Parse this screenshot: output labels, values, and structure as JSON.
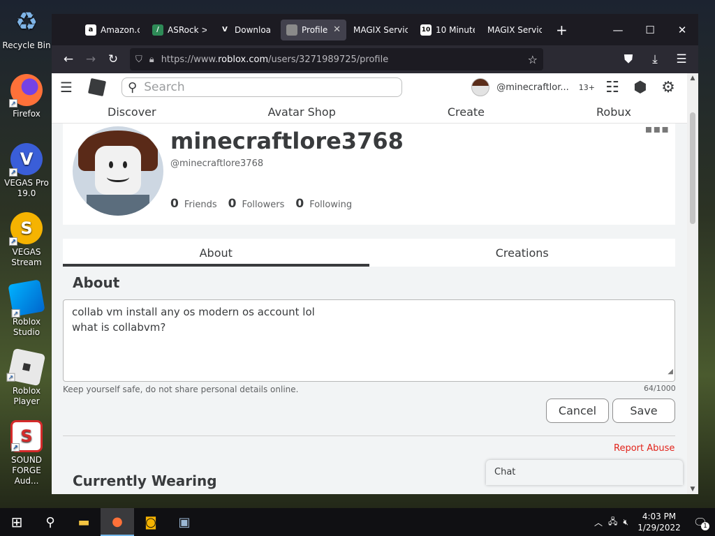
{
  "desktop": {
    "icons": [
      {
        "label": "Recycle Bin",
        "glyph": "♻",
        "color": "#2d8fd6"
      },
      {
        "label": "Firefox",
        "glyph": "●",
        "color": "#ff7139"
      },
      {
        "label": "VEGAS Pro 19.0",
        "glyph": "V",
        "color": "#3a6fd8"
      },
      {
        "label": "VEGAS Stream",
        "glyph": "S",
        "color": "#f5b301"
      },
      {
        "label": "Roblox Studio",
        "glyph": "■",
        "color": "#00a2ff"
      },
      {
        "label": "Roblox Player",
        "glyph": "◆",
        "color": "#e8e8e8"
      },
      {
        "label": "SOUND FORGE Aud...",
        "glyph": "S",
        "color": "#d42b2b"
      }
    ]
  },
  "browser": {
    "tabs": [
      {
        "label": "Amazon.c",
        "icon": "a",
        "color": "#ffffff",
        "active": false
      },
      {
        "label": "ASRock >",
        "icon": "/",
        "color": "#2e8b57",
        "active": false
      },
      {
        "label": "Downloa",
        "icon": "V",
        "color": "#1c1b22",
        "active": false
      },
      {
        "label": "Profile",
        "icon": "■",
        "color": "#7a7a7a",
        "active": true,
        "close": "✕"
      },
      {
        "label": "MAGIX Servic",
        "icon": "",
        "color": "",
        "active": false
      },
      {
        "label": "10 Minute",
        "icon": "10",
        "color": "#ffffff",
        "active": false
      },
      {
        "label": "MAGIX Servic",
        "icon": "",
        "color": "",
        "active": false
      }
    ],
    "new_tab": "+",
    "window_controls": {
      "minimize": "—",
      "maximize": "☐",
      "close": "✕"
    },
    "url": {
      "prefix": "https://www.",
      "host": "roblox.com",
      "path": "/users/3271989725/profile"
    }
  },
  "roblox": {
    "search_placeholder": "Search",
    "username_short": "@minecraftlor...",
    "age_badge": "13+",
    "nav": [
      "Discover",
      "Avatar Shop",
      "Create",
      "Robux"
    ],
    "profile": {
      "display_name": "minecraftlore3768",
      "handle": "@minecraftlore3768",
      "friends_count": "0",
      "friends_label": "Friends",
      "followers_count": "0",
      "followers_label": "Followers",
      "following_count": "0",
      "following_label": "Following",
      "more_dots": "▪▪▪"
    },
    "tabs": {
      "about": "About",
      "creations": "Creations"
    },
    "about": {
      "heading": "About",
      "text": "collab vm install any os modern os account lol\nwhat is collabvm?",
      "safe_note": "Keep yourself safe, do not share personal details online.",
      "char_count": "64/1000",
      "cancel": "Cancel",
      "save": "Save"
    },
    "report_abuse": "Report Abuse",
    "currently_wearing": "Currently Wearing",
    "chat": "Chat"
  },
  "taskbar": {
    "time": "4:03 PM",
    "date": "1/29/2022",
    "notification_count": "1"
  }
}
